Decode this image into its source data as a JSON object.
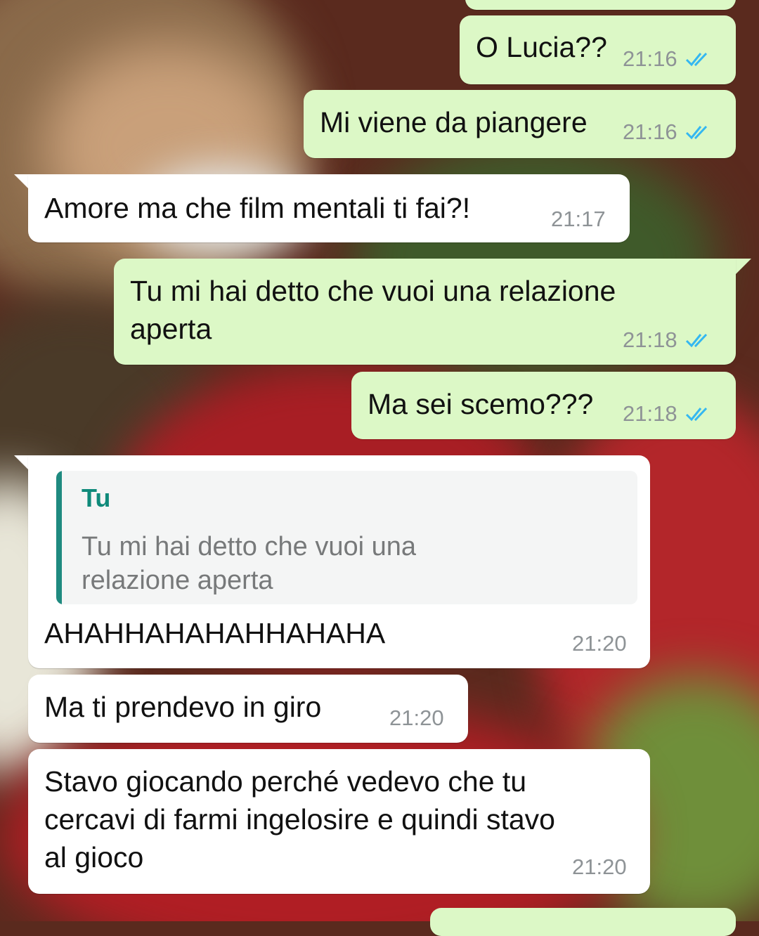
{
  "colors": {
    "outgoing_bubble": "#dcf8c6",
    "incoming_bubble": "#ffffff",
    "timestamp": "#8e9396",
    "read_ticks": "#34b7f1",
    "quote_accent": "#0f8a7a"
  },
  "icons": {
    "read_receipt": "double-check-icon"
  },
  "messages": [
    {
      "direction": "outgoing",
      "text": "O Lucia??",
      "time": "21:16",
      "status": "read"
    },
    {
      "direction": "outgoing",
      "text": "Mi viene da piangere",
      "time": "21:16",
      "status": "read"
    },
    {
      "direction": "incoming",
      "text": "Amore ma che film mentali ti fai?!",
      "time": "21:17"
    },
    {
      "direction": "outgoing",
      "text": "Tu mi hai detto che vuoi una relazione\naperta",
      "time": "21:18",
      "status": "read"
    },
    {
      "direction": "outgoing",
      "text": "Ma sei scemo???",
      "time": "21:18",
      "status": "read"
    },
    {
      "direction": "incoming",
      "quote": {
        "author": "Tu",
        "text": "Tu mi hai detto che vuoi una\nrelazione aperta"
      },
      "text": "AHAHHAHAHAHHAHAHA",
      "time": "21:20"
    },
    {
      "direction": "incoming",
      "text": "Ma ti prendevo in giro",
      "time": "21:20"
    },
    {
      "direction": "incoming",
      "text": "Stavo giocando perché vedevo che tu\ncercavi di farmi ingelosire e quindi stavo\nal gioco",
      "time": "21:20"
    }
  ]
}
